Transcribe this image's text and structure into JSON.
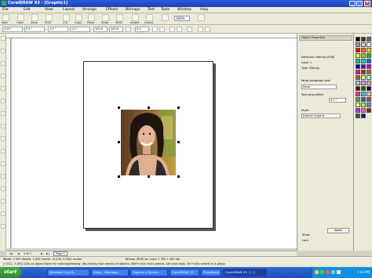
{
  "titlebar": {
    "title": "CorelDRAW X3 - [Graphic1]"
  },
  "menu": [
    "File",
    "Edit",
    "View",
    "Layout",
    "Arrange",
    "Effects",
    "Bitmaps",
    "Text",
    "Tools",
    "Window",
    "Help"
  ],
  "toolbar": {
    "zoom": "100%",
    "labels": [
      "New",
      "Open",
      "Save",
      "Print",
      "Cut",
      "Copy",
      "Paste",
      "Undo",
      "Redo",
      "Import",
      "Export",
      "Application",
      "Welcome"
    ]
  },
  "propbar": {
    "x": "4.25 \"",
    "y": "5.5 \"",
    "width": "1.5 \"",
    "height": "2.0 \"",
    "scale_w": "100.0",
    "scale_h": "100.0",
    "angle": "0.0"
  },
  "docker": {
    "tab": "Object Properties",
    "selection_label": "Selection: Bitmap (RGB)",
    "layer_label": "Layer 1",
    "type_label": "Type: Bitmap",
    "wrap_label": "Wrap paragraph text:",
    "wrap_value": "None",
    "offset_label": "Text wrap offset:",
    "offset_value": "0.1 \"",
    "style_label": "Style:",
    "style_value": "Default Graphic",
    "apply_button": "Apply",
    "checkbox1": "Show",
    "checkbox2": "Lock"
  },
  "pagebar": {
    "count": "1 of 1",
    "page_tab": "Page 1"
  },
  "status": {
    "line1": "Width: 1.500  Height: 2.000  Center: (4.250, 5.500) inches",
    "line2": "Bitmap (RGB) on Layer 1  300 x 400 dpi",
    "line3": "(7.012, 3.104)  Click an object twice for rotating/skewing; dbl-clicking tool selects all objects; Shift+click multi-selects; Alt+click digs; Ctrl+click selects in a group"
  },
  "taskbar": {
    "start": "start",
    "tasks": [
      "Windows Live M...",
      "Inbox - Windows...",
      "Capture a Screen...",
      "CorelDRAW X3",
      "PhotoDesk",
      "CorelDRAW X3 - [...]"
    ],
    "active_index": 5,
    "clock": "1:43 PM"
  },
  "colors": {
    "palette": [
      "#000000",
      "#333333",
      "#666666",
      "#999999",
      "#cccccc",
      "#ffffff",
      "#ff0000",
      "#ff6600",
      "#ffcc00",
      "#ffff00",
      "#99cc00",
      "#00cc00",
      "#00cc99",
      "#00ccff",
      "#0066ff",
      "#0000cc",
      "#6600cc",
      "#cc00cc",
      "#ff0099",
      "#993300",
      "#cc6600",
      "#996633",
      "#ccff99",
      "#99ffcc",
      "#99ccff",
      "#cc99ff",
      "#ff99cc",
      "#660000",
      "#006600",
      "#000066",
      "#ff3366",
      "#33ccff",
      "#ffcc99",
      "#669966",
      "#336699",
      "#cc3366",
      "#ffff99",
      "#99ff33",
      "#3399ff",
      "#9933ff",
      "#ff6699",
      "#663300",
      "#006666",
      "#330066"
    ]
  }
}
